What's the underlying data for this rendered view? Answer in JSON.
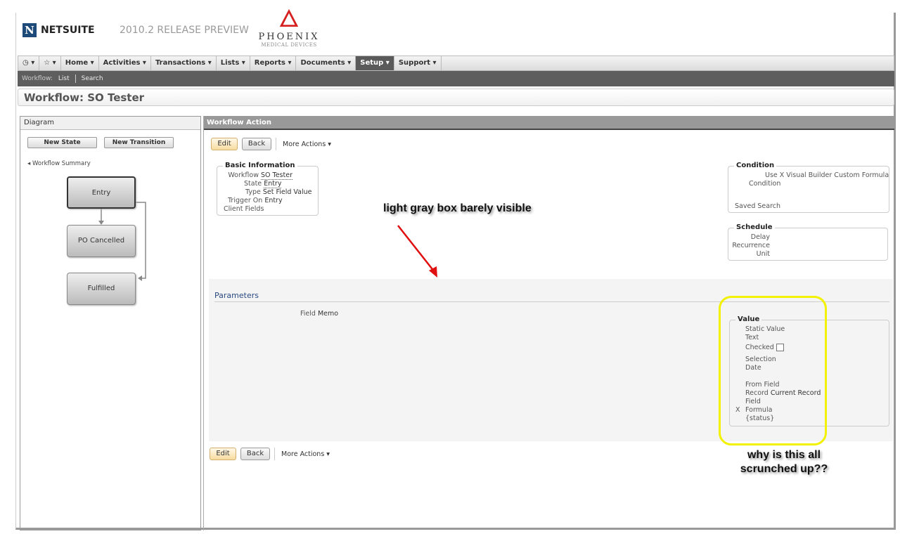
{
  "header": {
    "brand": "NETSUITE",
    "release": "2010.2 RELEASE PREVIEW",
    "company_name": "PHOENIX",
    "company_sub": "MEDICAL DEVICES"
  },
  "nav": {
    "items": [
      "Home",
      "Activities",
      "Transactions",
      "Lists",
      "Reports",
      "Documents",
      "Setup",
      "Support"
    ],
    "active": "Setup"
  },
  "subnav": {
    "label": "Workflow:",
    "links": [
      "List",
      "Search"
    ]
  },
  "page_title": "Workflow: SO Tester",
  "diagram": {
    "title": "Diagram",
    "new_state": "New State",
    "new_transition": "New Transition",
    "summary": "Workflow Summary",
    "states": [
      "Entry",
      "PO Cancelled",
      "Fulfilled"
    ]
  },
  "action": {
    "title": "Workflow Action",
    "edit": "Edit",
    "back": "Back",
    "more": "More Actions ▾",
    "basic": {
      "legend": "Basic Information",
      "workflow_label": "Workflow",
      "workflow": "SO Tester",
      "state_label": "State",
      "state": "Entry",
      "type_label": "Type",
      "type": "Set Field Value",
      "trigger_label": "Trigger On",
      "trigger": "Entry",
      "client_fields": "Client Fields"
    },
    "condition": {
      "legend": "Condition",
      "use_label": "Use",
      "use": "X Visual Builder  Custom Formula",
      "condition": "Condition",
      "saved_search": "Saved Search"
    },
    "schedule": {
      "legend": "Schedule",
      "delay": "Delay",
      "recurrence": "Recurrence",
      "unit": "Unit"
    },
    "parameters": {
      "title": "Parameters",
      "field_label": "Field",
      "field": "Memo"
    },
    "value": {
      "legend": "Value",
      "static_value": "Static Value",
      "text": "Text",
      "checked": "Checked",
      "selection": "Selection",
      "date": "Date",
      "from_field": "From Field",
      "record_label": "Record",
      "record": "Current Record",
      "field": "Field",
      "formula_mark": "X",
      "formula": "Formula",
      "formula_value": "{status}"
    }
  },
  "annotations": {
    "arrow_note": "light gray box barely visible",
    "value_note_1": "why is this all",
    "value_note_2": "scrunched up??"
  },
  "colors": {
    "accent_dark": "#5e5e5e",
    "annotation_red": "#e01010",
    "annotation_yellow": "#f2f200"
  }
}
